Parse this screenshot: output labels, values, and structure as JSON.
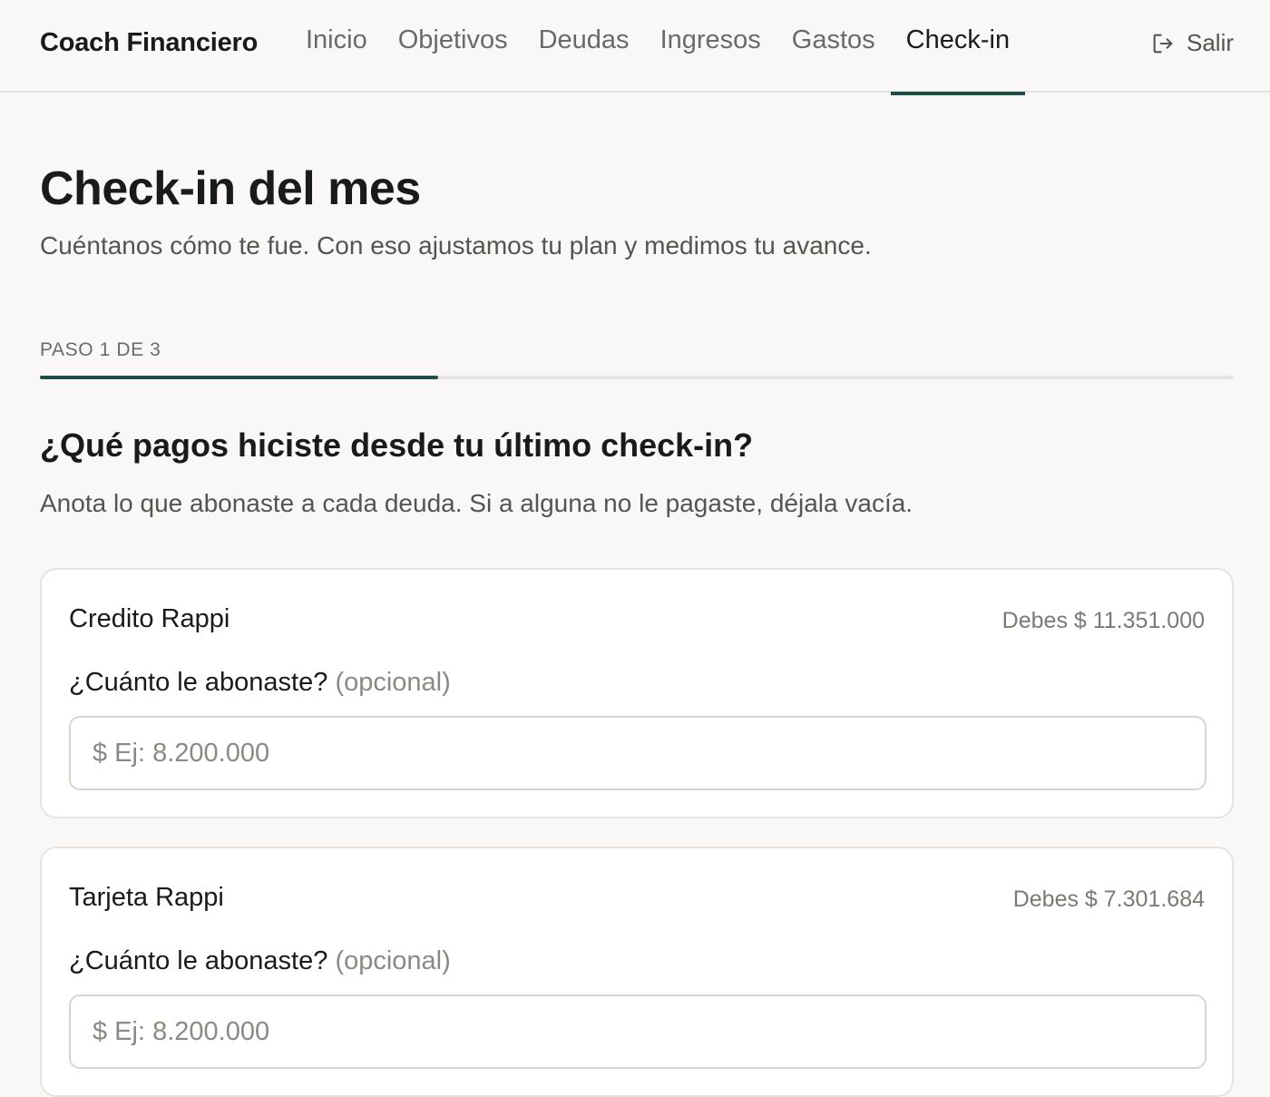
{
  "app": {
    "brand": "Coach Financiero"
  },
  "nav": {
    "items": [
      {
        "label": "Inicio",
        "active": false
      },
      {
        "label": "Objetivos",
        "active": false
      },
      {
        "label": "Deudas",
        "active": false
      },
      {
        "label": "Ingresos",
        "active": false
      },
      {
        "label": "Gastos",
        "active": false
      },
      {
        "label": "Check-in",
        "active": true
      }
    ],
    "logout_label": "Salir",
    "logout_icon": "logout-icon"
  },
  "header": {
    "title": "Check-in del mes",
    "subtitle": "Cuéntanos cómo te fue. Con eso ajustamos tu plan y medimos tu avance."
  },
  "step": {
    "label": "PASO 1 DE 3",
    "current": 1,
    "total": 3
  },
  "question": {
    "title": "¿Qué pagos hiciste desde tu último check-in?",
    "help": "Anota lo que abonaste a cada deuda. Si a alguna no le pagaste, déjala vacía."
  },
  "debts": [
    {
      "name": "Credito Rappi",
      "owed": "Debes $ 11.351.000",
      "field_label": "¿Cuánto le abonaste?",
      "field_optional": "(opcional)",
      "input_value": "",
      "input_placeholder": "$ Ej: 8.200.000"
    },
    {
      "name": "Tarjeta Rappi",
      "owed": "Debes $ 7.301.684",
      "field_label": "¿Cuánto le abonaste?",
      "field_optional": "(opcional)",
      "input_value": "",
      "input_placeholder": "$ Ej: 8.200.000"
    }
  ],
  "colors": {
    "accent": "#1f4d47",
    "background": "#f9f8f6",
    "card": "#ffffff",
    "muted_text": "#55554f"
  }
}
